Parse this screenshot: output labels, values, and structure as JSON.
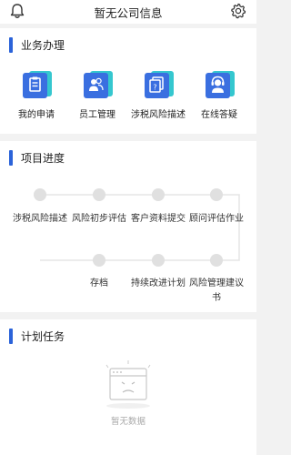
{
  "header": {
    "title": "暂无公司信息",
    "bell_icon": "bell-icon",
    "settings_icon": "gear-icon"
  },
  "business": {
    "title": "业务办理",
    "items": [
      {
        "label": "我的申请",
        "icon": "clipboard-icon"
      },
      {
        "label": "员工管理",
        "icon": "users-icon"
      },
      {
        "label": "涉税风险描述",
        "icon": "question-card-icon"
      },
      {
        "label": "在线答疑",
        "icon": "support-agent-icon"
      }
    ]
  },
  "progress": {
    "title": "项目进度",
    "steps": [
      {
        "label": "涉税风险描述"
      },
      {
        "label": "风险初步评估"
      },
      {
        "label": "客户资料提交"
      },
      {
        "label": "顾问评估作业"
      },
      {
        "label": "风险管理建议书"
      },
      {
        "label": "持续改进计划"
      },
      {
        "label": "存档"
      }
    ]
  },
  "plan": {
    "title": "计划任务",
    "empty_text": "暂无数据"
  },
  "colors": {
    "accent": "#2b63d9",
    "icon_blue": "#3a6fe0",
    "icon_teal": "#35c7cf",
    "dot": "#e0e0e0"
  }
}
